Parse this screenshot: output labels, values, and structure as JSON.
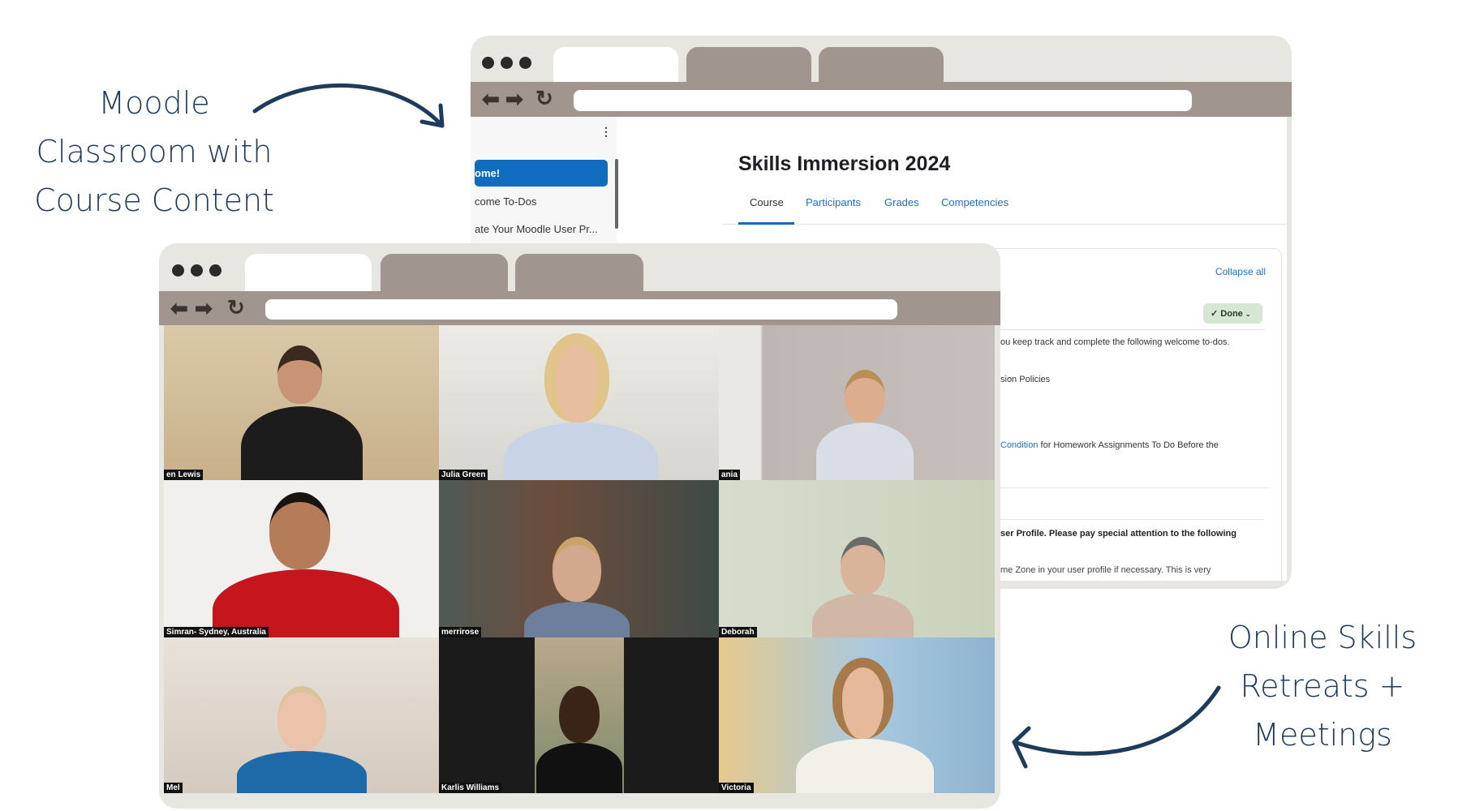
{
  "left_caption": [
    "Moodle",
    "Classroom with",
    "Course Content"
  ],
  "right_caption": [
    "Online Skills",
    "Retreats +",
    "Meetings"
  ],
  "moodle": {
    "sidebar_menu_icon": "vertical-dots-icon",
    "sidebar_items": [
      "ome!",
      "come To-Dos",
      "ate Your Moodle User Pr..."
    ],
    "title": "Skills Immersion 2024",
    "tabs": [
      "Course",
      "Participants",
      "Grades",
      "Competencies"
    ],
    "collapse_all": "Collapse all",
    "done_badge": "Done",
    "lines": {
      "l1": "ou keep track and complete the following welcome to-dos.",
      "l2": "sion Policies",
      "l3_link": "Condition",
      "l3_rest": " for Homework Assignments To Do Before the",
      "l4": "ser Profile.  Please pay special attention to the following",
      "l5": "me Zone in your user profile if necessary. This is very"
    }
  },
  "participants": [
    "en Lewis",
    "Julia Green",
    "ania",
    "Simran- Sydney, Australia",
    "merrirose",
    "Deborah",
    "Mel",
    "Karlis Williams",
    "Victoria"
  ],
  "colors": {
    "navy": "#1f3b5c",
    "chrome": "#e7e6e1",
    "tab": "#a0968f",
    "moodle_blue": "#1a73c6",
    "done_bg": "#d6e7d3"
  }
}
